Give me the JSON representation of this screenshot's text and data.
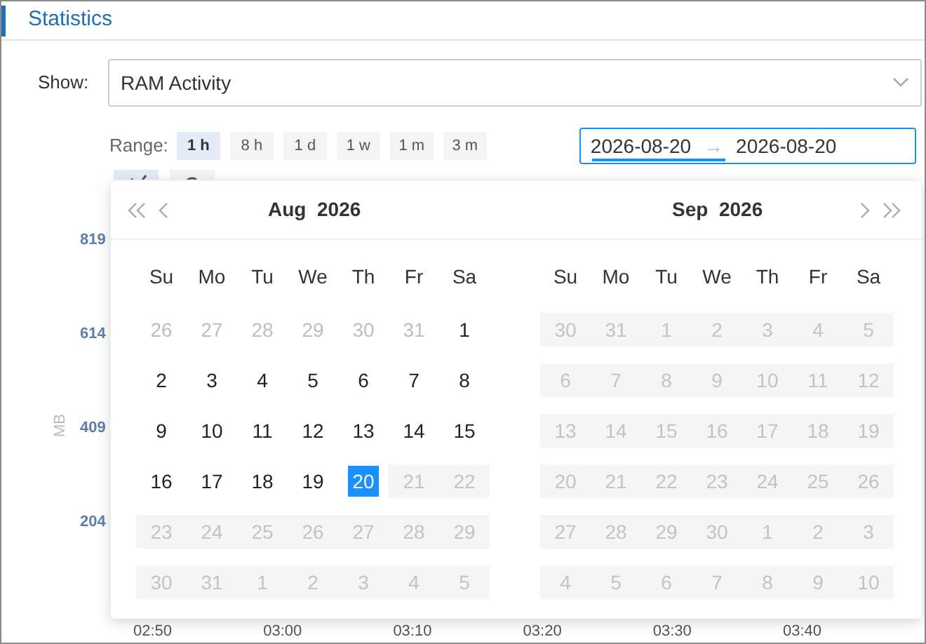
{
  "header": {
    "title": "Statistics"
  },
  "show": {
    "label": "Show:",
    "value": "RAM Activity"
  },
  "range": {
    "label": "Range:",
    "options": [
      {
        "label": "1 h",
        "selected": true
      },
      {
        "label": "8 h",
        "selected": false
      },
      {
        "label": "1 d",
        "selected": false
      },
      {
        "label": "1 w",
        "selected": false
      },
      {
        "label": "1 m",
        "selected": false
      },
      {
        "label": "3 m",
        "selected": false
      }
    ]
  },
  "view_buttons": [
    {
      "selected": true
    },
    {
      "selected": false
    }
  ],
  "date_range": {
    "start": "2026-08-20",
    "separator": "→",
    "end": "2026-08-20"
  },
  "chart": {
    "ylabel": "MB",
    "yticks": [
      "819",
      "614",
      "409",
      "204"
    ],
    "xticks": [
      "02:50",
      "03:00",
      "03:10",
      "03:20",
      "03:30",
      "03:40"
    ]
  },
  "calendar": {
    "months": [
      {
        "title": "Aug  2026",
        "weekdays": [
          "Su",
          "Mo",
          "Tu",
          "We",
          "Th",
          "Fr",
          "Sa"
        ],
        "days": [
          {
            "day": "26",
            "kind": "outside",
            "selected": false
          },
          {
            "day": "27",
            "kind": "outside",
            "selected": false
          },
          {
            "day": "28",
            "kind": "outside",
            "selected": false
          },
          {
            "day": "29",
            "kind": "outside",
            "selected": false
          },
          {
            "day": "30",
            "kind": "outside",
            "selected": false
          },
          {
            "day": "31",
            "kind": "outside",
            "selected": false
          },
          {
            "day": "1",
            "kind": "current",
            "selected": false
          },
          {
            "day": "2",
            "kind": "current",
            "selected": false
          },
          {
            "day": "3",
            "kind": "current",
            "selected": false
          },
          {
            "day": "4",
            "kind": "current",
            "selected": false
          },
          {
            "day": "5",
            "kind": "current",
            "selected": false
          },
          {
            "day": "6",
            "kind": "current",
            "selected": false
          },
          {
            "day": "7",
            "kind": "current",
            "selected": false
          },
          {
            "day": "8",
            "kind": "current",
            "selected": false
          },
          {
            "day": "9",
            "kind": "current",
            "selected": false
          },
          {
            "day": "10",
            "kind": "current",
            "selected": false
          },
          {
            "day": "11",
            "kind": "current",
            "selected": false
          },
          {
            "day": "12",
            "kind": "current",
            "selected": false
          },
          {
            "day": "13",
            "kind": "current",
            "selected": false
          },
          {
            "day": "14",
            "kind": "current",
            "selected": false
          },
          {
            "day": "15",
            "kind": "current",
            "selected": false
          },
          {
            "day": "16",
            "kind": "current",
            "selected": false
          },
          {
            "day": "17",
            "kind": "current",
            "selected": false
          },
          {
            "day": "18",
            "kind": "current",
            "selected": false
          },
          {
            "day": "19",
            "kind": "current",
            "selected": false
          },
          {
            "day": "20",
            "kind": "current",
            "selected": true
          },
          {
            "day": "21",
            "kind": "disabled",
            "selected": false
          },
          {
            "day": "22",
            "kind": "disabled",
            "selected": false
          },
          {
            "day": "23",
            "kind": "disabled",
            "selected": false
          },
          {
            "day": "24",
            "kind": "disabled",
            "selected": false
          },
          {
            "day": "25",
            "kind": "disabled",
            "selected": false
          },
          {
            "day": "26",
            "kind": "disabled",
            "selected": false
          },
          {
            "day": "27",
            "kind": "disabled",
            "selected": false
          },
          {
            "day": "28",
            "kind": "disabled",
            "selected": false
          },
          {
            "day": "29",
            "kind": "disabled",
            "selected": false
          },
          {
            "day": "30",
            "kind": "disabled",
            "selected": false
          },
          {
            "day": "31",
            "kind": "disabled",
            "selected": false
          },
          {
            "day": "1",
            "kind": "disabled",
            "selected": false
          },
          {
            "day": "2",
            "kind": "disabled",
            "selected": false
          },
          {
            "day": "3",
            "kind": "disabled",
            "selected": false
          },
          {
            "day": "4",
            "kind": "disabled",
            "selected": false
          },
          {
            "day": "5",
            "kind": "disabled",
            "selected": false
          }
        ]
      },
      {
        "title": "Sep  2026",
        "weekdays": [
          "Su",
          "Mo",
          "Tu",
          "We",
          "Th",
          "Fr",
          "Sa"
        ],
        "days": [
          {
            "day": "30",
            "kind": "disabled",
            "selected": false
          },
          {
            "day": "31",
            "kind": "disabled",
            "selected": false
          },
          {
            "day": "1",
            "kind": "disabled",
            "selected": false
          },
          {
            "day": "2",
            "kind": "disabled",
            "selected": false
          },
          {
            "day": "3",
            "kind": "disabled",
            "selected": false
          },
          {
            "day": "4",
            "kind": "disabled",
            "selected": false
          },
          {
            "day": "5",
            "kind": "disabled",
            "selected": false
          },
          {
            "day": "6",
            "kind": "disabled",
            "selected": false
          },
          {
            "day": "7",
            "kind": "disabled",
            "selected": false
          },
          {
            "day": "8",
            "kind": "disabled",
            "selected": false
          },
          {
            "day": "9",
            "kind": "disabled",
            "selected": false
          },
          {
            "day": "10",
            "kind": "disabled",
            "selected": false
          },
          {
            "day": "11",
            "kind": "disabled",
            "selected": false
          },
          {
            "day": "12",
            "kind": "disabled",
            "selected": false
          },
          {
            "day": "13",
            "kind": "disabled",
            "selected": false
          },
          {
            "day": "14",
            "kind": "disabled",
            "selected": false
          },
          {
            "day": "15",
            "kind": "disabled",
            "selected": false
          },
          {
            "day": "16",
            "kind": "disabled",
            "selected": false
          },
          {
            "day": "17",
            "kind": "disabled",
            "selected": false
          },
          {
            "day": "18",
            "kind": "disabled",
            "selected": false
          },
          {
            "day": "19",
            "kind": "disabled",
            "selected": false
          },
          {
            "day": "20",
            "kind": "disabled",
            "selected": false
          },
          {
            "day": "21",
            "kind": "disabled",
            "selected": false
          },
          {
            "day": "22",
            "kind": "disabled",
            "selected": false
          },
          {
            "day": "23",
            "kind": "disabled",
            "selected": false
          },
          {
            "day": "24",
            "kind": "disabled",
            "selected": false
          },
          {
            "day": "25",
            "kind": "disabled",
            "selected": false
          },
          {
            "day": "26",
            "kind": "disabled",
            "selected": false
          },
          {
            "day": "27",
            "kind": "disabled",
            "selected": false
          },
          {
            "day": "28",
            "kind": "disabled",
            "selected": false
          },
          {
            "day": "29",
            "kind": "disabled",
            "selected": false
          },
          {
            "day": "30",
            "kind": "disabled",
            "selected": false
          },
          {
            "day": "1",
            "kind": "disabled",
            "selected": false
          },
          {
            "day": "2",
            "kind": "disabled",
            "selected": false
          },
          {
            "day": "3",
            "kind": "disabled",
            "selected": false
          },
          {
            "day": "4",
            "kind": "disabled",
            "selected": false
          },
          {
            "day": "5",
            "kind": "disabled",
            "selected": false
          },
          {
            "day": "6",
            "kind": "disabled",
            "selected": false
          },
          {
            "day": "7",
            "kind": "disabled",
            "selected": false
          },
          {
            "day": "8",
            "kind": "disabled",
            "selected": false
          },
          {
            "day": "9",
            "kind": "disabled",
            "selected": false
          },
          {
            "day": "10",
            "kind": "disabled",
            "selected": false
          }
        ]
      }
    ]
  }
}
